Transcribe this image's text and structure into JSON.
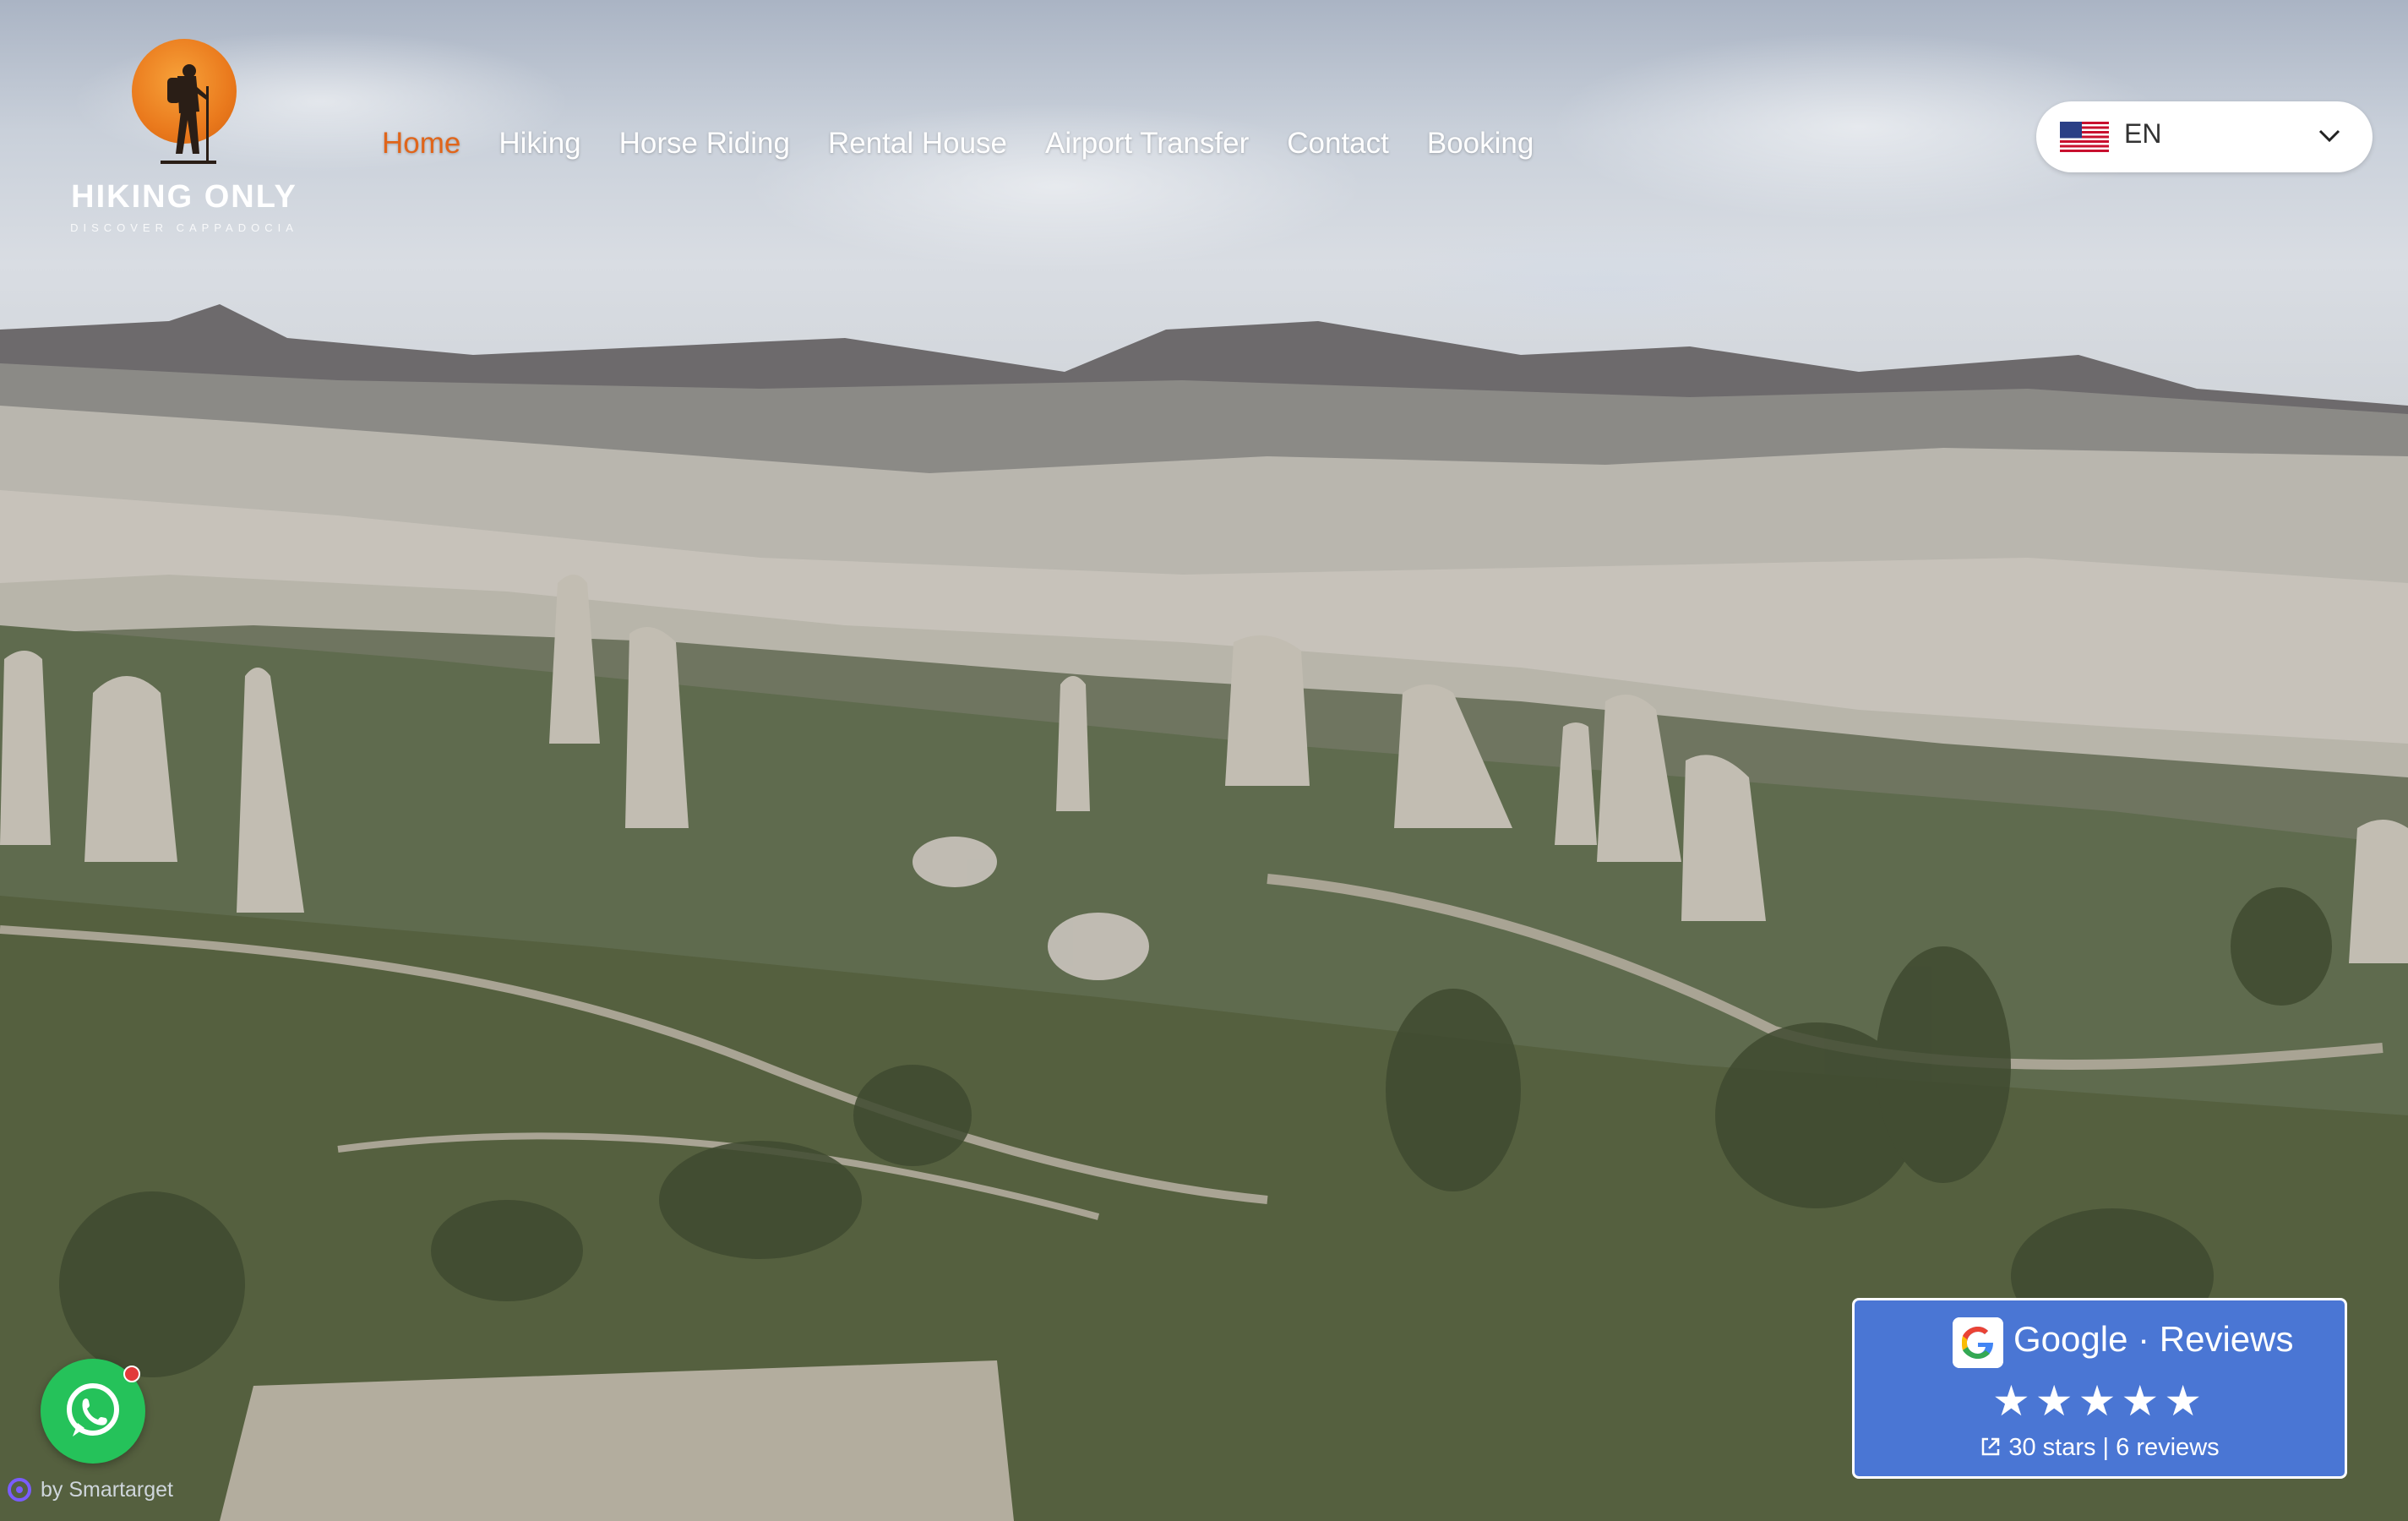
{
  "brand": {
    "name": "HIKING ONLY",
    "tagline": "DISCOVER CAPPADOCIA",
    "accent_color": "#e0651a"
  },
  "nav": {
    "items": [
      {
        "label": "Home",
        "active": true
      },
      {
        "label": "Hiking",
        "active": false
      },
      {
        "label": "Horse Riding",
        "active": false
      },
      {
        "label": "Rental House",
        "active": false
      },
      {
        "label": "Airport Transfer",
        "active": false
      },
      {
        "label": "Contact",
        "active": false
      },
      {
        "label": "Booking",
        "active": false
      }
    ]
  },
  "language": {
    "selected": "EN",
    "flag_icon": "us-flag-icon",
    "chevron_icon": "chevron-down-icon"
  },
  "whatsapp": {
    "icon": "whatsapp-icon",
    "color": "#25c25a"
  },
  "smartarget": {
    "label": "by Smartarget"
  },
  "reviews": {
    "title": "Google · Reviews",
    "stars": "★★★★★",
    "meta": "30 stars | 6 reviews",
    "background": "#4a76d4"
  }
}
